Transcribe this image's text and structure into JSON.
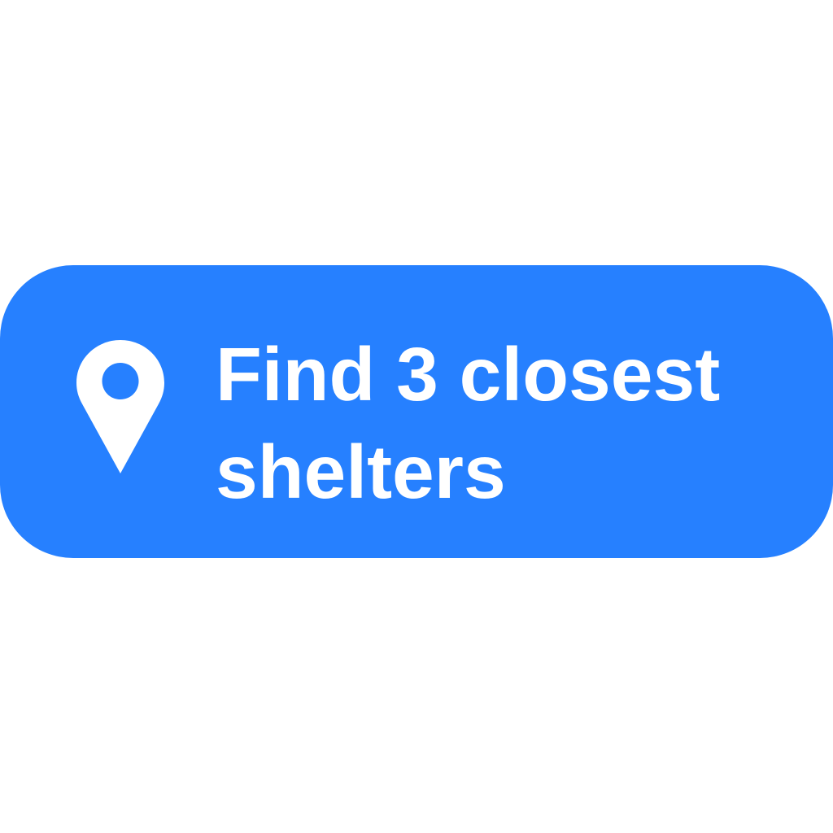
{
  "button": {
    "label_line_1": "Find 3 closest",
    "label_line_2": "shelters",
    "icon": "map-pin-icon",
    "background_color": "#2680FF",
    "text_color": "#FFFFFF"
  },
  "page": {
    "background_color": "#FFFFFF"
  }
}
